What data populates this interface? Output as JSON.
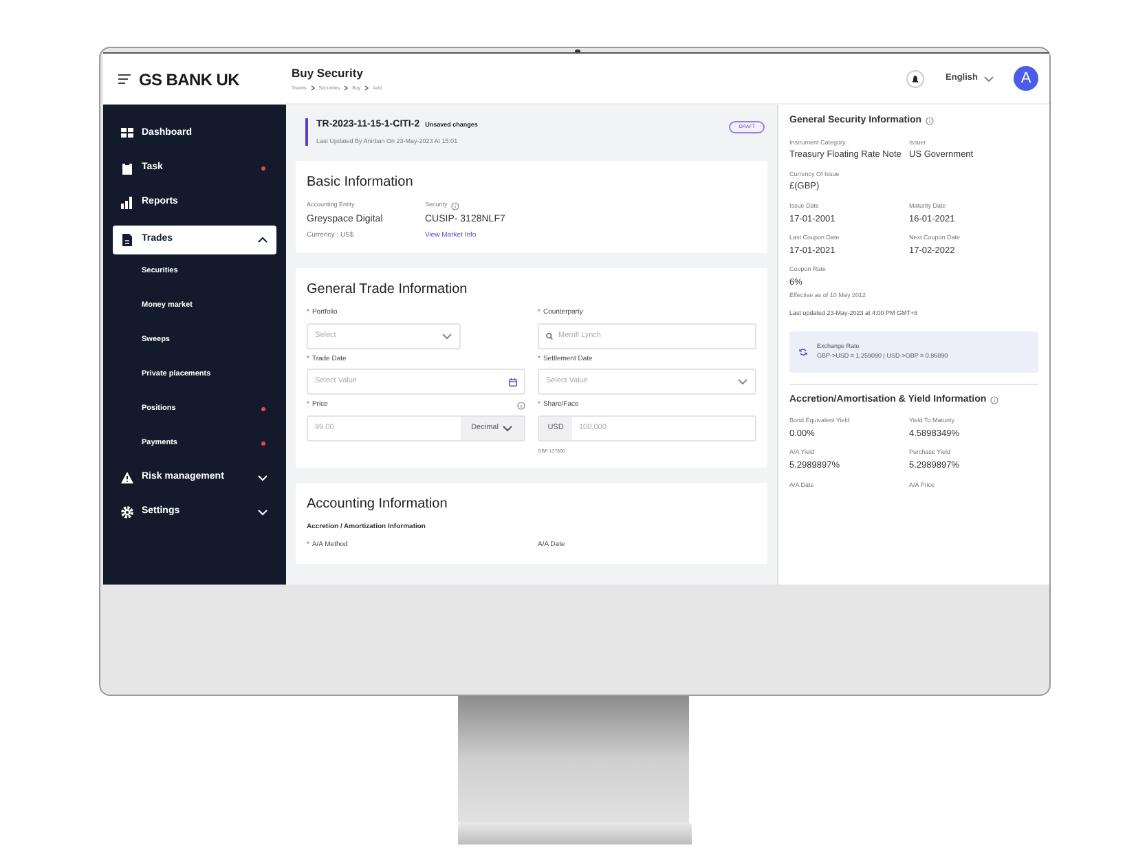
{
  "header": {
    "brand": "GS BANK UK",
    "page_title": "Buy Security",
    "breadcrumbs": [
      "Trades",
      "Securities",
      "Buy",
      "Add"
    ],
    "language": "English",
    "avatar": "A"
  },
  "sidebar": {
    "items": [
      {
        "label": "Dashboard",
        "kind": "link",
        "alert": false,
        "selected": false
      },
      {
        "label": "Task",
        "kind": "link",
        "alert": true,
        "selected": false
      },
      {
        "label": "Reports",
        "kind": "link",
        "alert": false,
        "selected": false
      },
      {
        "label": "Trades",
        "kind": "group",
        "alert": false,
        "selected": true,
        "expanded": true,
        "children": [
          {
            "label": "Securities",
            "alert": false
          },
          {
            "label": "Money market",
            "alert": false
          },
          {
            "label": "Sweeps",
            "alert": false
          },
          {
            "label": "Private placements",
            "alert": false
          },
          {
            "label": "Positions",
            "alert": true
          },
          {
            "label": "Payments",
            "alert": true
          }
        ]
      },
      {
        "label": "Risk management",
        "kind": "group",
        "alert": false,
        "selected": false,
        "expanded": false
      },
      {
        "label": "Settings",
        "kind": "group",
        "alert": false,
        "selected": false,
        "expanded": false
      }
    ]
  },
  "record": {
    "id": "TR-2023-11-15-1-CITI-2",
    "status_note": "Unsaved changes",
    "updated": "Last Updated By Anirban On 23-May-2023 At 15:01",
    "badge": "DRAFT"
  },
  "basic_information": {
    "title": "Basic Information",
    "fields": [
      {
        "label": "Accounting Entity",
        "value": "Greyspace Digital",
        "note": "Currency : US$",
        "kind": "note"
      },
      {
        "label": "Security",
        "info": true,
        "value": "CUSIP- 3128NLF7",
        "note": "View Market Info",
        "kind": "link"
      }
    ]
  },
  "general_trade_information": {
    "title": "General Trade Information",
    "fields": [
      {
        "label": "Portfolio",
        "required_mark": "*",
        "kind": "select",
        "placeholder": "Select"
      },
      {
        "label": "Counterparty",
        "required_mark": "*",
        "kind": "search",
        "placeholder": "Merrill Lynch"
      },
      {
        "label": "Trade Date",
        "required_mark": "*",
        "kind": "date",
        "placeholder": "Select Value"
      },
      {
        "label": "Settlement Date",
        "required_mark": "*",
        "kind": "select_wide",
        "placeholder": "Select Value"
      },
      {
        "label": "Price",
        "required_mark": "*",
        "kind": "price",
        "info": true,
        "placeholder": "99.00",
        "unit": "Decimal"
      },
      {
        "label": "Share/Face",
        "required_mark": "*",
        "kind": "amount",
        "prefix": "USD",
        "placeholder": "100,000",
        "hint": "GBP 137890"
      }
    ]
  },
  "accounting_information": {
    "title": "Accounting Information",
    "subtitle": "Accretion / Amortization Information",
    "fields": [
      {
        "label": "A/A Method",
        "required_mark": "*"
      },
      {
        "label": "A/A Date"
      }
    ]
  },
  "general_security_information": {
    "title": "General Security Information",
    "rows": [
      [
        {
          "label": "Instrument Category",
          "value": "Treasury Floating Rate Note"
        },
        {
          "label": "Issuer",
          "value": "US Government"
        }
      ],
      [
        {
          "label": "Currency Of Issue",
          "value": "£(GBP)"
        }
      ],
      [
        {
          "label": "Issue Date",
          "value": "17-01-2001"
        },
        {
          "label": "Maturity Date",
          "value": "16-01-2021"
        }
      ],
      [
        {
          "label": "Last Coupon Date",
          "value": "17-01-2021"
        },
        {
          "label": "Next Coupon Date",
          "value": "17-02-2022"
        }
      ],
      [
        {
          "label": "Coupon Rate",
          "value": "6%",
          "note": "Effective as of 10 May 2012"
        }
      ]
    ],
    "last_updated": "Last updated 23-May-2023 at 4:00 PM GMT+8",
    "exchange_rate": {
      "title": "Exchange Rate",
      "rates": "GBP->USD = 1.259090 | USD->GBP = 0.86890"
    }
  },
  "yield_information": {
    "title": "Accretion/Amortisation & Yield Information",
    "rows": [
      [
        {
          "label": "Bond Equivalent Yield",
          "value": "0.00%"
        },
        {
          "label": "Yield To Maturity",
          "value": "4.5898349%"
        }
      ],
      [
        {
          "label": "A/A Yield",
          "value": "5.2989897%"
        },
        {
          "label": "Purchase Yield",
          "value": "5.2989897%"
        }
      ],
      [
        {
          "label": "A/A Date"
        },
        {
          "label": "A/A Price"
        }
      ]
    ]
  }
}
